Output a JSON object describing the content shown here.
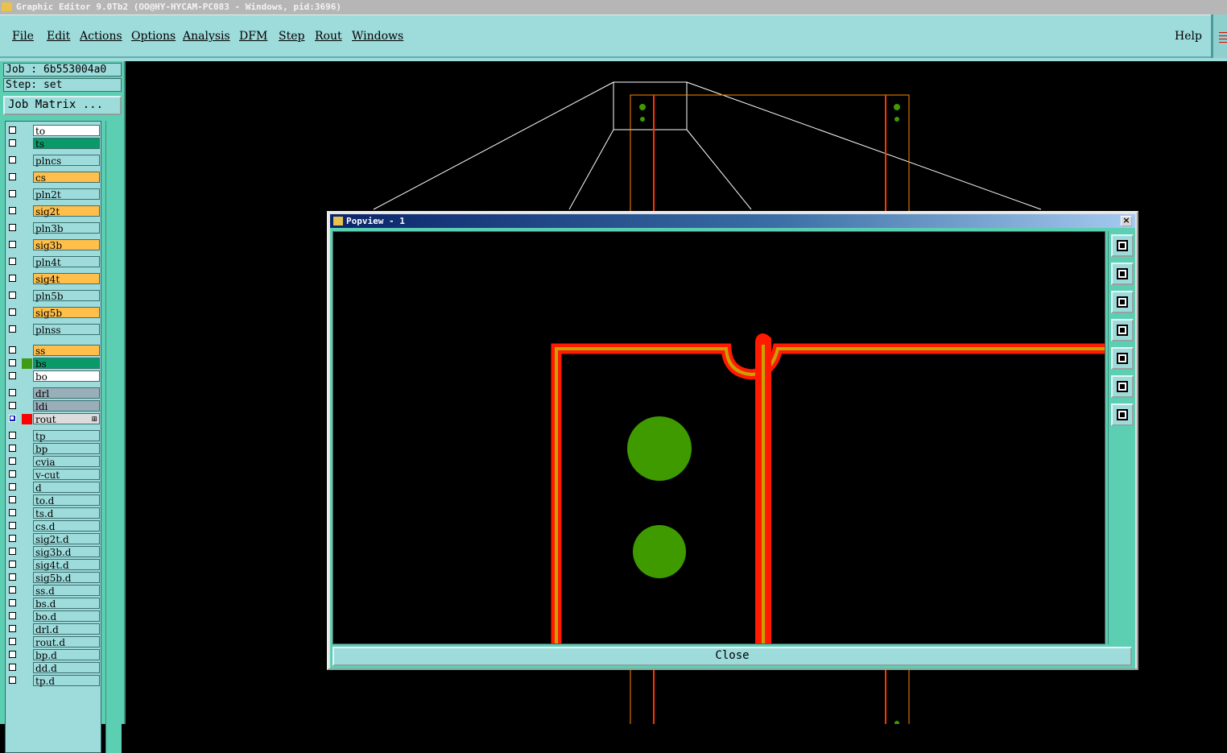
{
  "window": {
    "title": "Graphic Editor 9.0Tb2 (OO@HY-HYCAM-PC083 - Windows, pid:3696)"
  },
  "menu": {
    "items": [
      "File",
      "Edit",
      "Actions",
      "Options",
      "Analysis",
      "DFM",
      "Step",
      "Rout",
      "Windows"
    ],
    "help": "Help"
  },
  "job": {
    "label": "Job : 6b553004a0",
    "step": "Step: set",
    "matrix_button": "Job Matrix ..."
  },
  "layers": [
    {
      "name": "to",
      "color": "#ffffff",
      "swatch": ""
    },
    {
      "name": "ts",
      "color": "#0a9a6a",
      "swatch": ""
    },
    {
      "name": "plncs",
      "color": "#9edbdb",
      "swatch": ""
    },
    {
      "name": "cs",
      "color": "#ffbf4a",
      "swatch": ""
    },
    {
      "name": "pln2t",
      "color": "#9edbdb",
      "swatch": ""
    },
    {
      "name": "sig2t",
      "color": "#ffbf4a",
      "swatch": ""
    },
    {
      "name": "pln3b",
      "color": "#9edbdb",
      "swatch": ""
    },
    {
      "name": "sig3b",
      "color": "#ffbf4a",
      "swatch": ""
    },
    {
      "name": "pln4t",
      "color": "#9edbdb",
      "swatch": ""
    },
    {
      "name": "sig4t",
      "color": "#ffbf4a",
      "swatch": ""
    },
    {
      "name": "pln5b",
      "color": "#9edbdb",
      "swatch": ""
    },
    {
      "name": "sig5b",
      "color": "#ffbf4a",
      "swatch": ""
    },
    {
      "name": "plnss",
      "color": "#9edbdb",
      "swatch": ""
    },
    {
      "name": "ss",
      "color": "#ffbf4a",
      "swatch": ""
    },
    {
      "name": "bs",
      "color": "#0a9a6a",
      "swatch": "#3f9a14"
    },
    {
      "name": "bo",
      "color": "#ffffff",
      "swatch": ""
    },
    {
      "name": "drl",
      "color": "#99aeb8",
      "swatch": ""
    },
    {
      "name": "ldi",
      "color": "#99aeb8",
      "swatch": ""
    },
    {
      "name": "rout",
      "color": "#dcdcdc",
      "swatch": "#ff0000",
      "selected": true,
      "dots": "⊞"
    },
    {
      "name": "tp",
      "color": "#9edbdb",
      "swatch": ""
    },
    {
      "name": "bp",
      "color": "#9edbdb",
      "swatch": ""
    },
    {
      "name": "cvia",
      "color": "#9edbdb",
      "swatch": ""
    },
    {
      "name": "v-cut",
      "color": "#9edbdb",
      "swatch": ""
    },
    {
      "name": "d",
      "color": "#9edbdb",
      "swatch": ""
    },
    {
      "name": "to.d",
      "color": "#9edbdb",
      "swatch": ""
    },
    {
      "name": "ts.d",
      "color": "#9edbdb",
      "swatch": ""
    },
    {
      "name": "cs.d",
      "color": "#9edbdb",
      "swatch": ""
    },
    {
      "name": "sig2t.d",
      "color": "#9edbdb",
      "swatch": ""
    },
    {
      "name": "sig3b.d",
      "color": "#9edbdb",
      "swatch": ""
    },
    {
      "name": "sig4t.d",
      "color": "#9edbdb",
      "swatch": ""
    },
    {
      "name": "sig5b.d",
      "color": "#9edbdb",
      "swatch": ""
    },
    {
      "name": "ss.d",
      "color": "#9edbdb",
      "swatch": ""
    },
    {
      "name": "bs.d",
      "color": "#9edbdb",
      "swatch": ""
    },
    {
      "name": "bo.d",
      "color": "#9edbdb",
      "swatch": ""
    },
    {
      "name": "drl.d",
      "color": "#9edbdb",
      "swatch": ""
    },
    {
      "name": "rout.d",
      "color": "#9edbdb",
      "swatch": ""
    },
    {
      "name": "bp.d",
      "color": "#9edbdb",
      "swatch": ""
    },
    {
      "name": "dd.d",
      "color": "#9edbdb",
      "swatch": ""
    },
    {
      "name": "tp.d",
      "color": "#9edbdb",
      "swatch": ""
    }
  ],
  "popview": {
    "title": "Popview - 1",
    "close_x": "×",
    "close_button": "Close",
    "tools": [
      "zoom-home-icon",
      "pan-up-icon",
      "pan-down-icon",
      "pan-left-icon",
      "pan-right-icon",
      "zoom-fit-icon",
      "zoom-in-icon"
    ]
  },
  "colors": {
    "rout_outer": "#ff1a00",
    "rout_inner": "#c8a200",
    "pad": "#3f9a00",
    "profile": "#ff8a00"
  }
}
